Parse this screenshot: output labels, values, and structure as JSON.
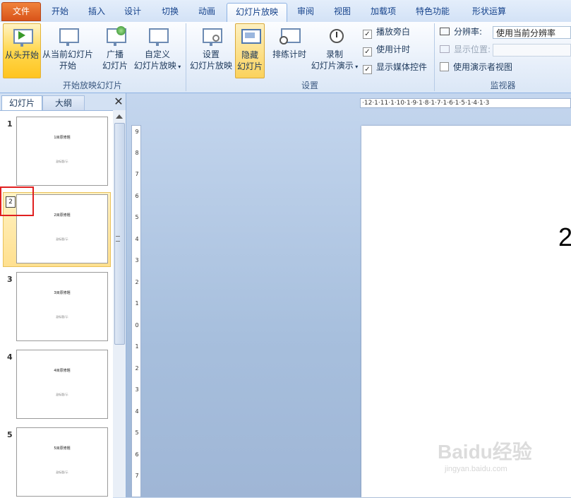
{
  "tabs": [
    {
      "label": "文件",
      "kind": "file"
    },
    {
      "label": "开始"
    },
    {
      "label": "插入"
    },
    {
      "label": "设计"
    },
    {
      "label": "切换"
    },
    {
      "label": "动画"
    },
    {
      "label": "幻灯片放映",
      "active": true
    },
    {
      "label": "审阅"
    },
    {
      "label": "视图"
    },
    {
      "label": "加载项"
    },
    {
      "label": "特色功能"
    },
    {
      "label": "形状运算"
    }
  ],
  "ribbon": {
    "group1": {
      "label": "开始放映幻灯片",
      "from_start": "从头开始",
      "from_current_1": "从当前幻灯片",
      "from_current_2": "开始",
      "broadcast_1": "广播",
      "broadcast_2": "幻灯片",
      "custom_1": "自定义",
      "custom_2": "幻灯片放映"
    },
    "group2": {
      "label": "设置",
      "setup_1": "设置",
      "setup_2": "幻灯片放映",
      "hide_1": "隐藏",
      "hide_2": "幻灯片",
      "rehearse": "排练计时",
      "record_1": "录制",
      "record_2": "幻灯片演示",
      "play_narration": "播放旁白",
      "use_timings": "使用计时",
      "show_media": "显示媒体控件"
    },
    "group3": {
      "label": "监视器",
      "resolution_label": "分辨率:",
      "resolution_value": "使用当前分辨率",
      "show_on": "显示位置:",
      "presenter_view": "使用演示者视图"
    }
  },
  "pane": {
    "tab_slides": "幻灯片",
    "tab_outline": "大纲",
    "close": "✕",
    "thumbs": [
      {
        "num": "1",
        "title": "1目原修題",
        "sub": "副标题/示"
      },
      {
        "num": "",
        "title": "2目原修題",
        "sub": "副标题/示",
        "hidden_badge": "2"
      },
      {
        "num": "3",
        "title": "3目原修題",
        "sub": "副标题/示"
      },
      {
        "num": "4",
        "title": "4目原修題",
        "sub": "副标题/示"
      },
      {
        "num": "5",
        "title": "5目原修題",
        "sub": "副标题/示"
      }
    ]
  },
  "ruler_h": "·12·1·11·1·10·1·9·1·8·1·7·1·6·1·5·1·4·1·3",
  "ruler_v": [
    "9",
    "8",
    "7",
    "6",
    "5",
    "4",
    "3",
    "2",
    "1",
    "0",
    "1",
    "2",
    "3",
    "4",
    "5",
    "6",
    "7"
  ],
  "slide": {
    "title": "2"
  },
  "watermark": {
    "brand": "Baidu经验",
    "url": "jingyan.baidu.com"
  }
}
